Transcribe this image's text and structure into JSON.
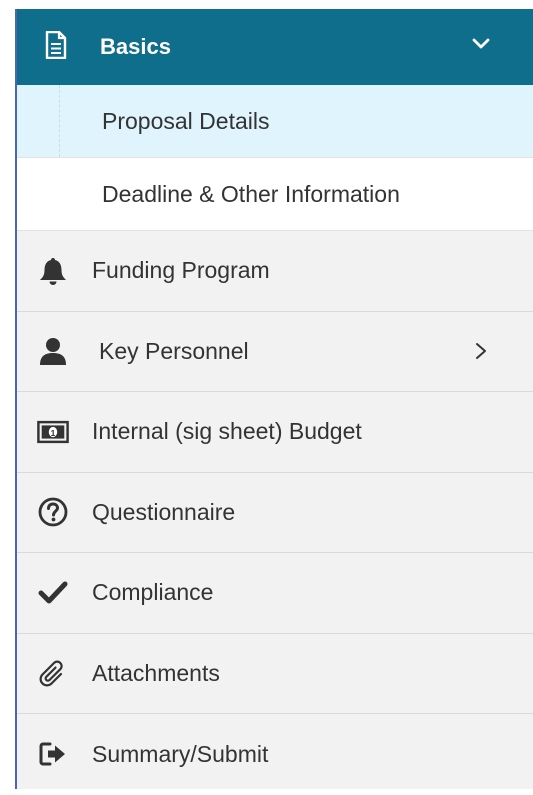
{
  "header": {
    "title": "Basics",
    "icon": "document-icon",
    "chevron": "chevron-down-icon",
    "color": "#0f6e8c"
  },
  "sub_items": [
    {
      "label": "Proposal Details",
      "active": true
    },
    {
      "label": "Deadline & Other Information",
      "active": false
    }
  ],
  "nav_items": [
    {
      "label": "Funding Program",
      "icon": "bell-icon"
    },
    {
      "label": "Key Personnel",
      "icon": "user-icon",
      "has_submenu": true
    },
    {
      "label": "Internal (sig sheet) Budget",
      "icon": "money-icon"
    },
    {
      "label": "Questionnaire",
      "icon": "question-circle-icon"
    },
    {
      "label": "Compliance",
      "icon": "check-icon"
    },
    {
      "label": "Attachments",
      "icon": "paperclip-icon"
    },
    {
      "label": "Summary/Submit",
      "icon": "sign-out-icon"
    }
  ]
}
